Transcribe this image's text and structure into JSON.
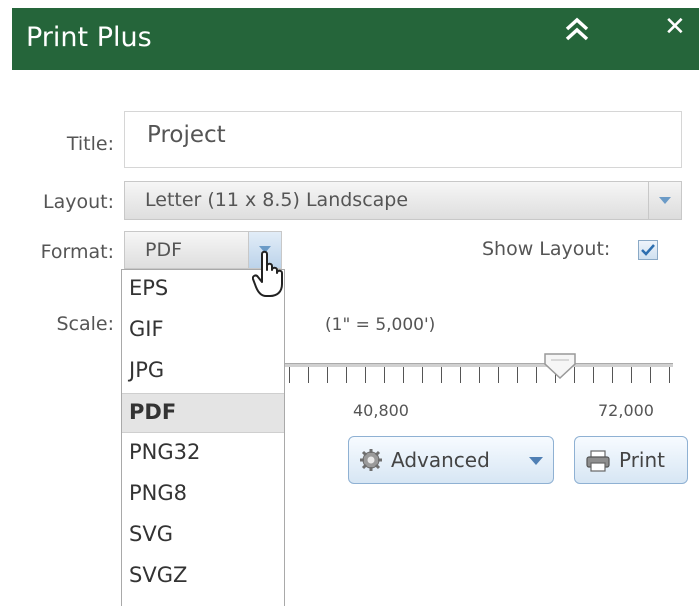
{
  "panel": {
    "title": "Print Plus",
    "collapse_icon": "double-chevron-up-icon",
    "close_label": "✕",
    "header_color": "#25653a"
  },
  "form": {
    "title_label": "Title:",
    "title_value": "Project",
    "layout_label": "Layout:",
    "layout_value": "Letter (11 x 8.5) Landscape",
    "format_label": "Format:",
    "format_value": "PDF",
    "show_layout_label": "Show Layout:",
    "show_layout_checked": true,
    "scale_label": "Scale:",
    "scale_text": "(1\" = 5,000')"
  },
  "format_options": [
    "EPS",
    "GIF",
    "JPG",
    "PDF",
    "PNG32",
    "PNG8",
    "SVG",
    "SVGZ"
  ],
  "selected_format_index": 3,
  "slider": {
    "tick_labels": [
      "40,800",
      "72,000"
    ]
  },
  "buttons": {
    "advanced_label": "Advanced",
    "advanced_icon": "gear-icon",
    "print_label": "Print",
    "print_icon": "printer-icon"
  }
}
